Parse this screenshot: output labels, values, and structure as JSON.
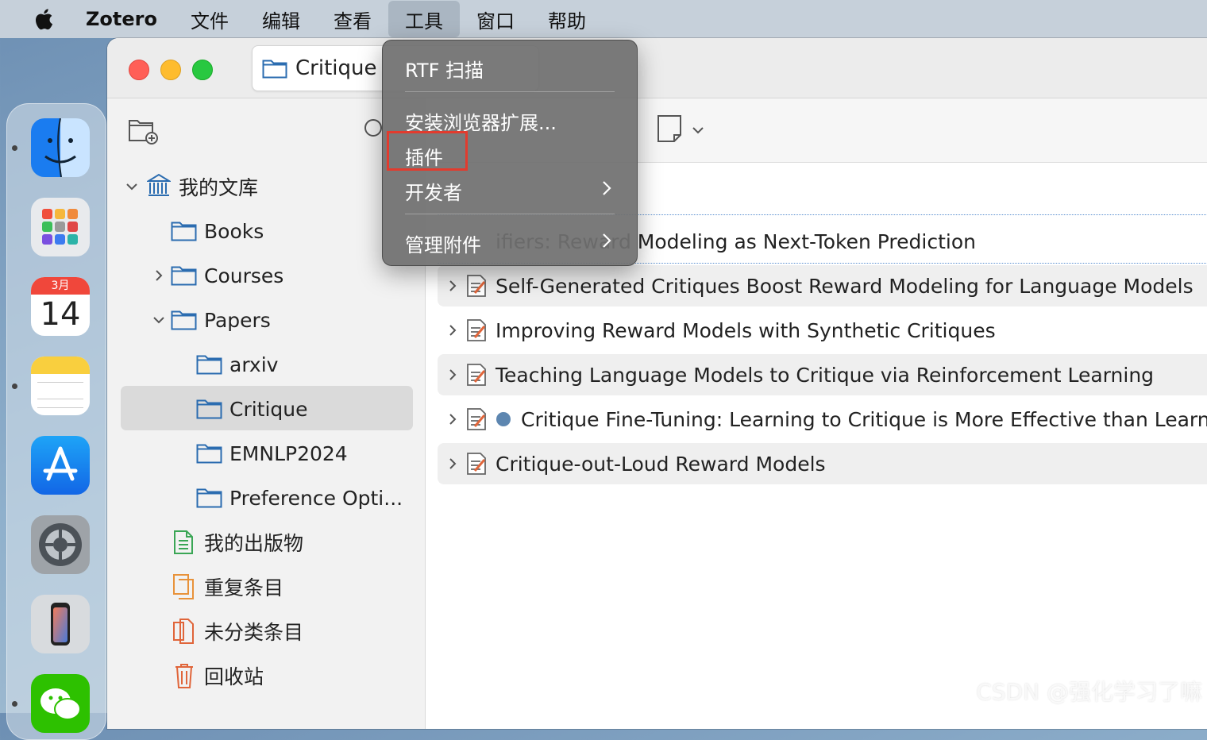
{
  "menubar": {
    "app": "Zotero",
    "items": [
      "文件",
      "编辑",
      "查看",
      "工具",
      "窗口",
      "帮助"
    ]
  },
  "window": {
    "tab_title": "Critique"
  },
  "sidebar": {
    "library": "我的文库",
    "collections": [
      "Books",
      "Courses",
      "Papers",
      "arxiv",
      "Critique",
      "EMNLP2024",
      "Preference Opti..."
    ],
    "special": [
      "我的出版物",
      "重复条目",
      "未分类条目",
      "回收站"
    ]
  },
  "tools_menu": {
    "items": [
      "RTF 扫描",
      "安装浏览器扩展...",
      "插件",
      "开发者",
      "管理附件"
    ],
    "highlighted": "插件"
  },
  "items": [
    "ifiers: Reward Modeling as Next-Token Prediction",
    "Self-Generated Critiques Boost Reward Modeling for Language Models",
    "Improving Reward Models with Synthetic Critiques",
    "Teaching Language Models to Critique via Reinforcement Learning",
    "Critique Fine-Tuning: Learning to Critique is More Effective than Learnin",
    "Critique-out-Loud Reward Models"
  ],
  "watermark": "CSDN @强化学习了嘛",
  "colors": {
    "accent": "#2b6cb0",
    "highlight_box": "#e23b2e",
    "unread_dot": "#5d86b0"
  }
}
